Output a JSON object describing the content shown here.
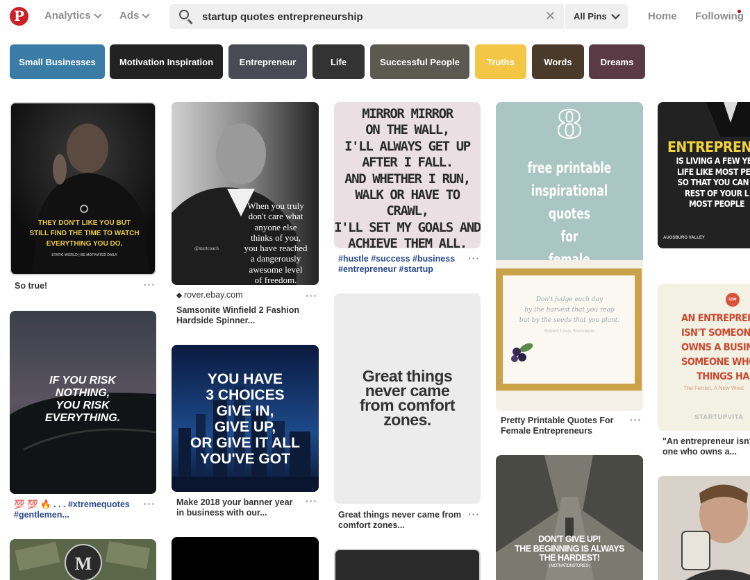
{
  "header": {
    "logo": "P",
    "analytics": "Analytics",
    "ads": "Ads",
    "search_value": "startup quotes entrepreneurship",
    "clear": "✕",
    "scope": "All Pins",
    "home": "Home",
    "following": "Following"
  },
  "guides": [
    {
      "label": "Small Businesses",
      "color": "#3a7ca5"
    },
    {
      "label": "Motivation Inspiration",
      "color": "#222222"
    },
    {
      "label": "Entrepreneur",
      "color": "#4a4a55"
    },
    {
      "label": "Life",
      "color": "#333333"
    },
    {
      "label": "Successful People",
      "color": "#5a5a50"
    },
    {
      "label": "Truths",
      "color": "#f3c645"
    },
    {
      "label": "Words",
      "color": "#4a3a2a"
    },
    {
      "label": "Dreams",
      "color": "#5a3a45"
    }
  ],
  "pins": {
    "rock": {
      "quote1": "THEY DON'T LIKE YOU BUT",
      "quote2": "STILL FIND THE TIME TO WATCH",
      "quote3": "EVERYTHING YOU DO.",
      "credit": "STATIC WORLD | BE MOTIVATED DAILY",
      "caption": "So true!"
    },
    "statham": {
      "quote": [
        "When you truly",
        "don't care what",
        "anyone else",
        "thinks of you,",
        "you have reached",
        "a dangerously",
        "awesome level",
        "of freedom."
      ],
      "credit": "@startcoach",
      "source": "rover.ebay.com",
      "caption1": "Samsonite Winfield 2 Fashion",
      "caption2": "Hardside Spinner..."
    },
    "mirror": {
      "quote": [
        "MIRROR MIRROR",
        "ON THE WALL,",
        "I'LL ALWAYS GET UP",
        "AFTER I FALL.",
        "AND WHETHER I RUN,",
        "WALK OR HAVE TO CRAWL,",
        "I'LL SET MY GOALS AND",
        "ACHIEVE THEM ALL."
      ],
      "tags1": "#hustle #success #business",
      "tags2": "#entrepreneur #startup"
    },
    "printable": {
      "number": "8",
      "quote": [
        "free printable",
        "inspirational quotes",
        "for",
        "female entrepreneurs"
      ],
      "script1": "Don't judge each day",
      "script2": "by the harvest that you reap",
      "script3": "but by the seeds that you plant.",
      "author": "Robert Louis Stevenson",
      "caption1": "Pretty Printable Quotes For",
      "caption2": "Female Entrepreneurs"
    },
    "suit": {
      "title": "ENTREPRENE",
      "quote": [
        "IS LIVING A FEW YEA",
        "LIFE LIKE MOST PEO",
        "SO THAT YOU CAN S",
        "REST OF YOUR L",
        "MOST PEOPLE"
      ],
      "credit": "AUGSBURG VALLEY"
    },
    "car": {
      "quote": [
        "IF YOU RISK",
        "NOTHING,",
        "YOU RISK",
        "EVERYTHING."
      ],
      "tags1": "💯 💯 🔥 . . . #xtremequotes",
      "tags2": "#gentlemen..."
    },
    "city": {
      "quote": [
        "YOU HAVE",
        "3 CHOICES",
        "GIVE IN,",
        "GIVE UP,",
        "OR GIVE IT ALL",
        "YOU'VE GOT"
      ],
      "caption1": "Make 2018 your banner year",
      "caption2": "in business with our..."
    },
    "comfort": {
      "quote": [
        "Great things",
        "never came",
        "from comfort",
        "zones."
      ],
      "caption1": "Great things never came from",
      "caption2": "comfort zones..."
    },
    "owns": {
      "badge": "ESM",
      "quote": [
        "AN ENTREPREI",
        "ISN'T SOMEONI",
        "OWNS A BUSINE",
        "SOMEONE WHO",
        "THINGS HAPP"
      ],
      "author": "The Ferrari, A New West",
      "brand": "STARTUPVITA",
      "caption1": "\"An entrepreneur isn't",
      "caption2": "one who owns a..."
    },
    "street": {
      "quote": [
        "DON'T GIVE UP!",
        "THE BEGINNING IS ALWAYS",
        "THE HARDEST!"
      ],
      "credit": "| MOTIVATIONSTORIES |"
    }
  },
  "more": "···"
}
